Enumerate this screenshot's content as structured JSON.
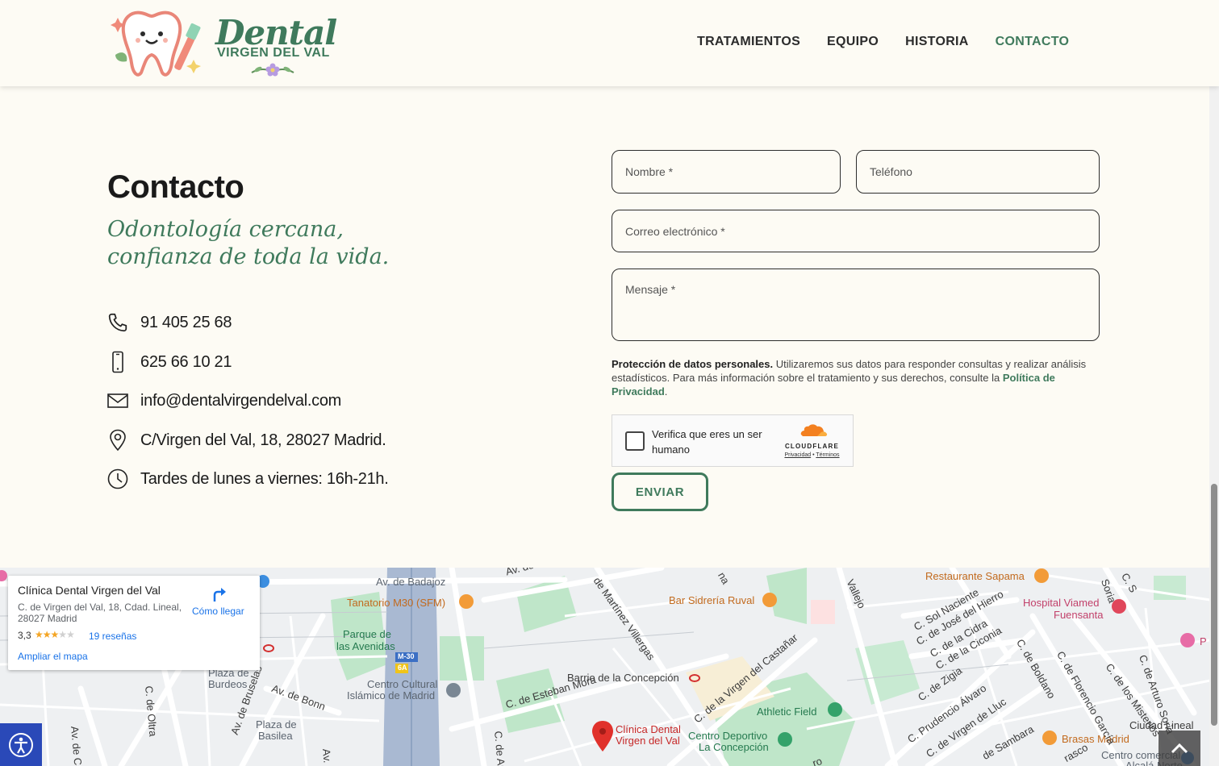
{
  "brand": {
    "title": "Dental",
    "subtitle": "VIRGEN DEL VAL",
    "primary_color": "#3f7a5c"
  },
  "nav": {
    "items": [
      {
        "label": "TRATAMIENTOS",
        "active": false
      },
      {
        "label": "EQUIPO",
        "active": false
      },
      {
        "label": "HISTORIA",
        "active": false
      },
      {
        "label": "CONTACTO",
        "active": true
      }
    ]
  },
  "contact": {
    "title": "Contacto",
    "tagline_line1": "Odontología cercana,",
    "tagline_line2": "confianza de toda la vida.",
    "items": [
      {
        "icon": "phone-icon",
        "text": "91 405 25 68"
      },
      {
        "icon": "mobile-icon",
        "text": "625 66 10 21"
      },
      {
        "icon": "mail-icon",
        "text": "info@dentalvirgendelval.com"
      },
      {
        "icon": "location-pin-icon",
        "text": "C/Virgen del Val, 18, 28027 Madrid."
      },
      {
        "icon": "clock-icon",
        "text": "Tardes de lunes a viernes: 16h-21h."
      }
    ]
  },
  "form": {
    "name_placeholder": "Nombre *",
    "phone_placeholder": "Teléfono",
    "email_placeholder": "Correo electrónico *",
    "message_placeholder": "Mensaje *",
    "privacy_bold": "Protección de datos personales.",
    "privacy_text": " Utilizaremos sus datos para responder consultas y realizar análisis estadísticos. Para más información sobre el tratamiento y sus derechos, consulte la ",
    "privacy_link": "Política de Privacidad",
    "privacy_end": ".",
    "captcha_label": "Verifica que eres un ser humano",
    "captcha_brand": "CLOUDFLARE",
    "captcha_privacy": "Privacidad",
    "captcha_terms": "Términos",
    "submit_label": "ENVIAR"
  },
  "map": {
    "card": {
      "name": "Clínica Dental Virgen del Val",
      "address": "C. de Virgen del Val, 18, Cdad. Lineal, 28027 Madrid",
      "rating": "3,3",
      "stars": "★★★★★",
      "rating_value": 3.3,
      "reviews": "19 reseñas",
      "directions": "Cómo llegar",
      "enlarge": "Ampliar el mapa"
    },
    "labels": [
      {
        "text": "Av. de Badajoz",
        "cls": "gray"
      },
      {
        "text": "Tanatorio M30 (SFM)",
        "cls": "orange"
      },
      {
        "text": "Parque de",
        "cls": "green"
      },
      {
        "text": "las Avenidas",
        "cls": "green"
      },
      {
        "text": "Bar Sidrería Ruval",
        "cls": "orange"
      },
      {
        "text": "Restaurante Sapama",
        "cls": "orange"
      },
      {
        "text": "Hospital Viamed",
        "cls": "pink"
      },
      {
        "text": "Fuensanta",
        "cls": "pink"
      },
      {
        "text": "Barrio de la Concepción",
        "cls": ""
      },
      {
        "text": "Centro Cultural",
        "cls": "gray"
      },
      {
        "text": "Islámico de Madrid",
        "cls": "gray"
      },
      {
        "text": "Plaza de",
        "cls": "gray"
      },
      {
        "text": "Burdeos",
        "cls": "gray"
      },
      {
        "text": "Plaza de",
        "cls": "gray"
      },
      {
        "text": "Basilea",
        "cls": "gray"
      },
      {
        "text": "C. de Esteban Mora",
        "cls": ""
      },
      {
        "text": "Clínica Dental",
        "cls": "red"
      },
      {
        "text": "Virgen del Val",
        "cls": "red"
      },
      {
        "text": "Athletic Field",
        "cls": "green"
      },
      {
        "text": "Centro Deportivo",
        "cls": "green"
      },
      {
        "text": "La Concepción",
        "cls": "green"
      },
      {
        "text": "Brasas Madrid",
        "cls": "orange"
      },
      {
        "text": "Ciudad Lineal",
        "cls": ""
      },
      {
        "text": "Centro comercial",
        "cls": "gray"
      },
      {
        "text": "Av. de",
        "cls": ""
      },
      {
        "text": "Vallejo",
        "cls": ""
      },
      {
        "text": "Soria",
        "cls": ""
      },
      {
        "text": "C. Sol Naciente",
        "cls": ""
      },
      {
        "text": "C. de José del Hierro",
        "cls": ""
      },
      {
        "text": "C. de la Cidra",
        "cls": ""
      },
      {
        "text": "C. de la Ciconia",
        "cls": ""
      },
      {
        "text": "C. de Boldano",
        "cls": ""
      },
      {
        "text": "C. de Florencio García",
        "cls": ""
      },
      {
        "text": "C. de los Misterios",
        "cls": ""
      },
      {
        "text": "C. de Arturo Soria",
        "cls": ""
      },
      {
        "text": "C. de Zigia",
        "cls": ""
      },
      {
        "text": "C. Prudencio Álvaro",
        "cls": ""
      },
      {
        "text": "C. de Virgen de Lluc",
        "cls": ""
      },
      {
        "text": "de Sambara",
        "cls": ""
      },
      {
        "text": "C. de la Virgen del Castañar",
        "cls": ""
      },
      {
        "text": "de Martínez Villergas",
        "cls": ""
      },
      {
        "text": "Av. de Bonn",
        "cls": ""
      },
      {
        "text": "Av. de Bruselas",
        "cls": ""
      },
      {
        "text": "C. de Oltra",
        "cls": ""
      },
      {
        "text": "Av. de Ca",
        "cls": ""
      },
      {
        "text": "M-30",
        "cls": ""
      },
      {
        "text": "6A",
        "cls": ""
      },
      {
        "text": "C. de Anton",
        "cls": ""
      },
      {
        "text": "Av.",
        "cls": ""
      },
      {
        "text": "rasco",
        "cls": ""
      },
      {
        "text": "na",
        "cls": ""
      },
      {
        "text": "ro",
        "cls": ""
      },
      {
        "text": "C. S",
        "cls": ""
      },
      {
        "text": "P",
        "cls": "pink"
      },
      {
        "text": "Alcalá Norte",
        "cls": "gray"
      }
    ]
  }
}
